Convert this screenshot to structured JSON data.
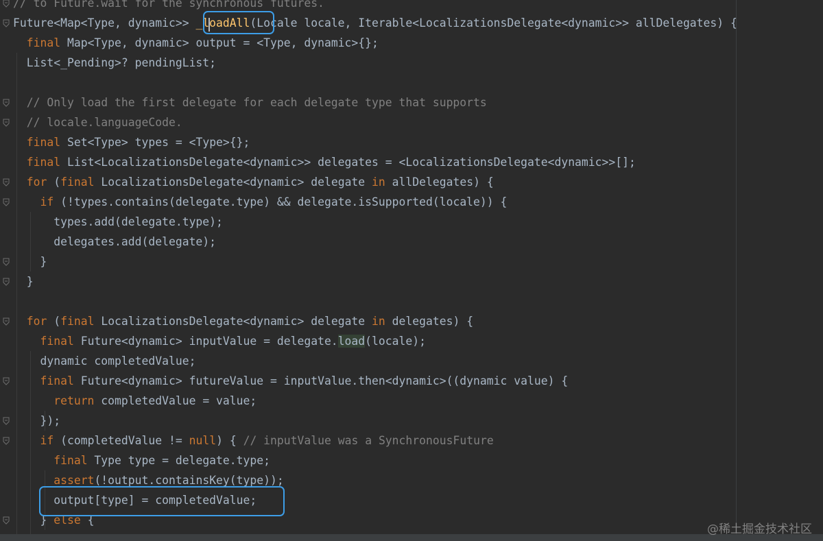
{
  "editor": {
    "language": "Dart",
    "code_lines": [
      {
        "segments": [
          {
            "t": "// to Future.wait for the synchronous futures.",
            "c": "cm"
          }
        ]
      },
      {
        "segments": [
          {
            "t": "Future<Map<Type, dynamic>> "
          },
          {
            "t": "_loadAll",
            "c": "fn"
          },
          {
            "t": "(Locale locale, Iterable<LocalizationsDelegate<dynamic>> allDelegates) {"
          }
        ]
      },
      {
        "segments": [
          {
            "t": "  "
          },
          {
            "t": "final",
            "c": "kw"
          },
          {
            "t": " Map<Type, dynamic> output = <Type, dynamic>{};"
          }
        ]
      },
      {
        "segments": [
          {
            "t": "  List<_Pending>? pendingList;"
          }
        ]
      },
      {
        "segments": []
      },
      {
        "segments": [
          {
            "t": "  "
          },
          {
            "t": "// Only load the first delegate for each delegate type that supports",
            "c": "cm"
          }
        ]
      },
      {
        "segments": [
          {
            "t": "  "
          },
          {
            "t": "// locale.languageCode.",
            "c": "cm"
          }
        ]
      },
      {
        "segments": [
          {
            "t": "  "
          },
          {
            "t": "final",
            "c": "kw"
          },
          {
            "t": " Set<Type> types = <Type>{};"
          }
        ]
      },
      {
        "segments": [
          {
            "t": "  "
          },
          {
            "t": "final",
            "c": "kw"
          },
          {
            "t": " List<LocalizationsDelegate<dynamic>> delegates = <LocalizationsDelegate<dynamic>>[];"
          }
        ]
      },
      {
        "segments": [
          {
            "t": "  "
          },
          {
            "t": "for",
            "c": "kw"
          },
          {
            "t": " ("
          },
          {
            "t": "final",
            "c": "kw"
          },
          {
            "t": " LocalizationsDelegate<dynamic> delegate "
          },
          {
            "t": "in",
            "c": "kw"
          },
          {
            "t": " allDelegates) {"
          }
        ]
      },
      {
        "segments": [
          {
            "t": "    "
          },
          {
            "t": "if",
            "c": "kw"
          },
          {
            "t": " (!types.contains(delegate.type) && delegate.isSupported(locale)) {"
          }
        ]
      },
      {
        "segments": [
          {
            "t": "      types.add(delegate.type);"
          }
        ]
      },
      {
        "segments": [
          {
            "t": "      delegates.add(delegate);"
          }
        ]
      },
      {
        "segments": [
          {
            "t": "    }"
          }
        ]
      },
      {
        "segments": [
          {
            "t": "  }"
          }
        ]
      },
      {
        "segments": []
      },
      {
        "segments": [
          {
            "t": "  "
          },
          {
            "t": "for",
            "c": "kw"
          },
          {
            "t": " ("
          },
          {
            "t": "final",
            "c": "kw"
          },
          {
            "t": " LocalizationsDelegate<dynamic> delegate "
          },
          {
            "t": "in",
            "c": "kw"
          },
          {
            "t": " delegates) {"
          }
        ]
      },
      {
        "segments": [
          {
            "t": "    "
          },
          {
            "t": "final",
            "c": "kw"
          },
          {
            "t": " Future<dynamic> inputValue = delegate."
          },
          {
            "t": "load",
            "c": "hl"
          },
          {
            "t": "(locale);"
          }
        ]
      },
      {
        "segments": [
          {
            "t": "    dynamic completedValue;"
          }
        ]
      },
      {
        "segments": [
          {
            "t": "    "
          },
          {
            "t": "final",
            "c": "kw"
          },
          {
            "t": " Future<dynamic> futureValue = inputValue.then<dynamic>((dynamic value) {"
          }
        ]
      },
      {
        "segments": [
          {
            "t": "      "
          },
          {
            "t": "return",
            "c": "kw"
          },
          {
            "t": " completedValue = value;"
          }
        ]
      },
      {
        "segments": [
          {
            "t": "    });"
          }
        ]
      },
      {
        "segments": [
          {
            "t": "    "
          },
          {
            "t": "if",
            "c": "kw"
          },
          {
            "t": " (completedValue != "
          },
          {
            "t": "null",
            "c": "kw"
          },
          {
            "t": ") { "
          },
          {
            "t": "// inputValue was a SynchronousFuture",
            "c": "cm"
          }
        ]
      },
      {
        "segments": [
          {
            "t": "      "
          },
          {
            "t": "final",
            "c": "kw"
          },
          {
            "t": " Type type = delegate.type;"
          }
        ]
      },
      {
        "segments": [
          {
            "t": "      "
          },
          {
            "t": "assert",
            "c": "kw"
          },
          {
            "t": "(!output.containsKey(type));"
          }
        ]
      },
      {
        "segments": [
          {
            "t": "      output[type] = completedValue;"
          }
        ]
      },
      {
        "segments": [
          {
            "t": "    } "
          },
          {
            "t": "else",
            "c": "kw"
          },
          {
            "t": " {"
          }
        ]
      }
    ],
    "fold_marker_lines": [
      0,
      1,
      5,
      6,
      9,
      10,
      13,
      14,
      16,
      19,
      21,
      22,
      26
    ],
    "colors": {
      "background": "#2b2b2b",
      "default_text": "#a9b7c6",
      "keyword": "#cc7832",
      "comment": "#808080",
      "function_decl": "#ffc66d",
      "usage_highlight": "#344134",
      "callout_border": "#3d9ee8"
    },
    "callouts": [
      {
        "label": "_loadAll",
        "meaning": "function-name-highlight"
      },
      {
        "label": "output[type] = completedValue;",
        "meaning": "assignment-highlight"
      }
    ]
  },
  "watermark": "@稀土掘金技术社区"
}
